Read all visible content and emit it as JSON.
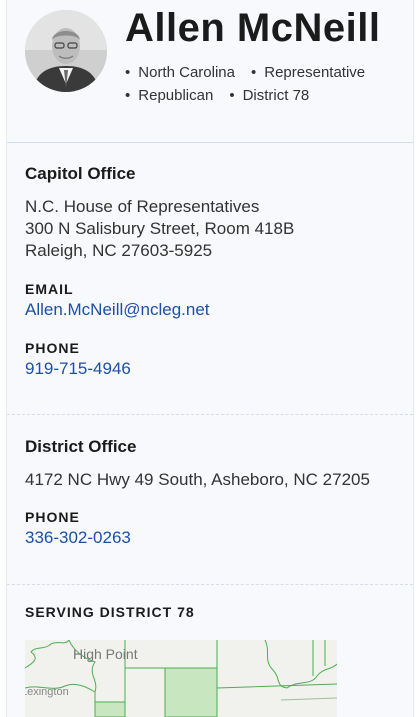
{
  "header": {
    "name": "Allen McNeill",
    "meta": [
      "North Carolina",
      "Representative",
      "Republican",
      "District 78"
    ]
  },
  "capitol_office": {
    "title": "Capitol Office",
    "address_lines": [
      "N.C. House of Representatives",
      "300 N Salisbury Street, Room 418B",
      "Raleigh, NC 27603-5925"
    ],
    "email_label": "EMAIL",
    "email": "Allen.McNeill@ncleg.net",
    "phone_label": "PHONE",
    "phone": "919-715-4946"
  },
  "district_office": {
    "title": "District Office",
    "address": "4172 NC Hwy 49 South, Asheboro, NC 27205",
    "phone_label": "PHONE",
    "phone": "336-302-0263"
  },
  "serving": {
    "label": "SERVING DISTRICT 78",
    "map_labels": [
      "High Point",
      "Lexington"
    ]
  },
  "colors": {
    "link": "#1d4fa8",
    "map_border": "#4caf50",
    "map_fill": "#c8e6c0"
  }
}
